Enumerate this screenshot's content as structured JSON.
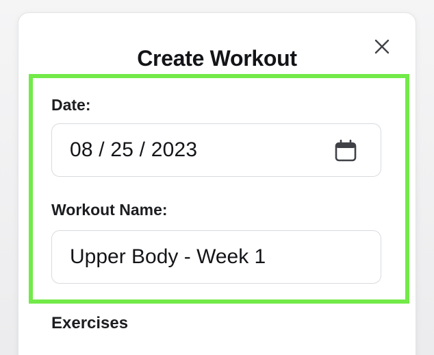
{
  "dialog": {
    "title": "Create Workout"
  },
  "form": {
    "date_label": "Date:",
    "date_value": "08 / 25 / 2023",
    "workout_name_label": "Workout Name:",
    "workout_name_value": "Upper Body - Week 1"
  },
  "sections": {
    "exercises_label": "Exercises"
  },
  "icons": {
    "close": "close-icon",
    "calendar": "calendar-icon"
  },
  "colors": {
    "highlight": "#72ea48",
    "text": "#141518",
    "border": "#d8dadf"
  }
}
